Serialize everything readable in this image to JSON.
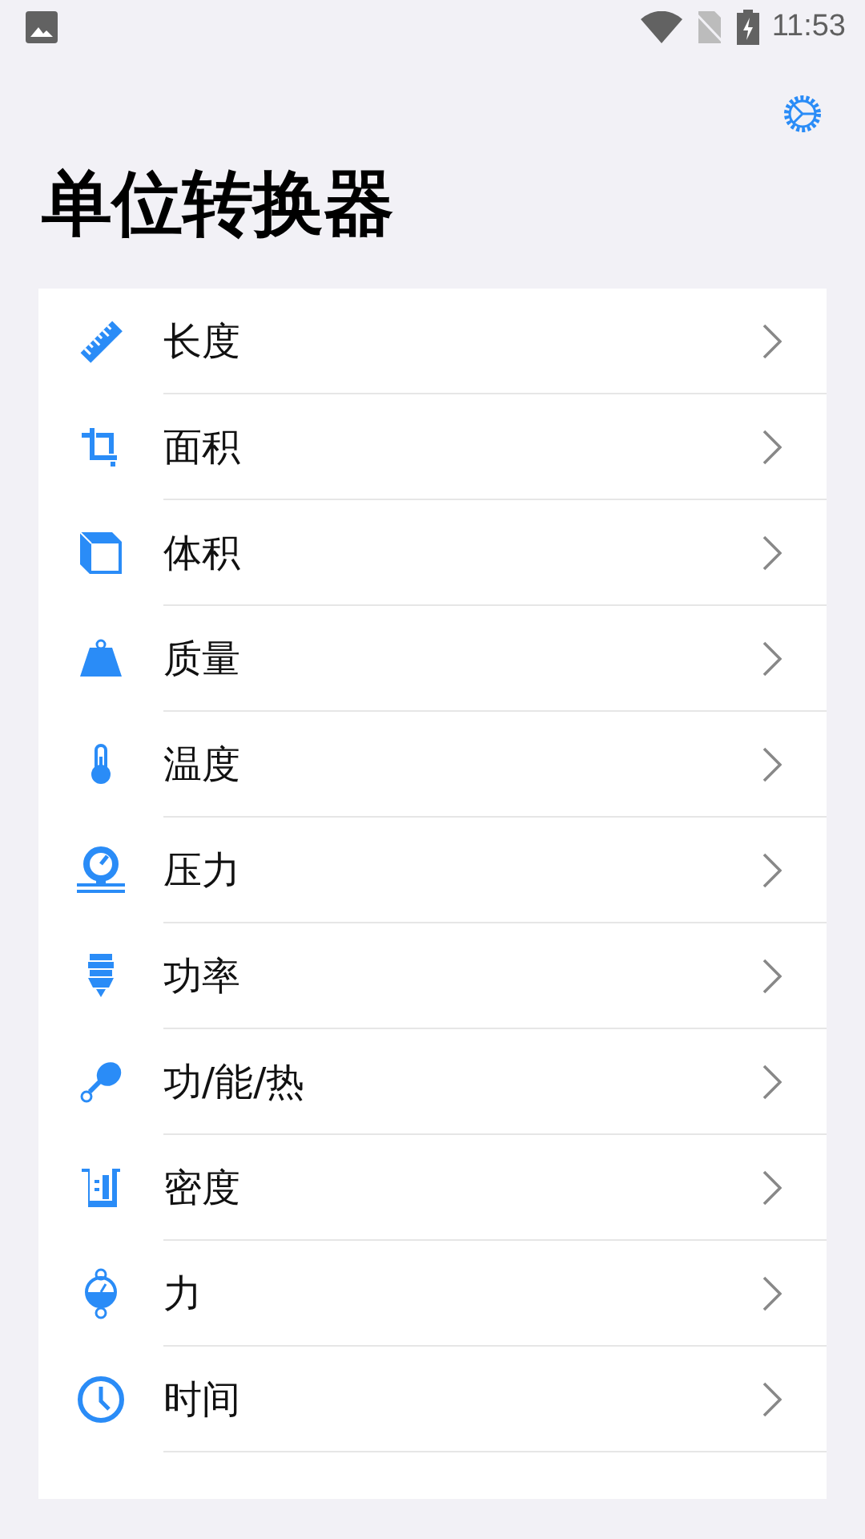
{
  "status_bar": {
    "time": "11:53"
  },
  "title": "单位转换器",
  "items": [
    {
      "label": "长度"
    },
    {
      "label": "面积"
    },
    {
      "label": "体积"
    },
    {
      "label": "质量"
    },
    {
      "label": "温度"
    },
    {
      "label": "压力"
    },
    {
      "label": "功率"
    },
    {
      "label": "功/能/热"
    },
    {
      "label": "密度"
    },
    {
      "label": "力"
    },
    {
      "label": "时间"
    }
  ]
}
